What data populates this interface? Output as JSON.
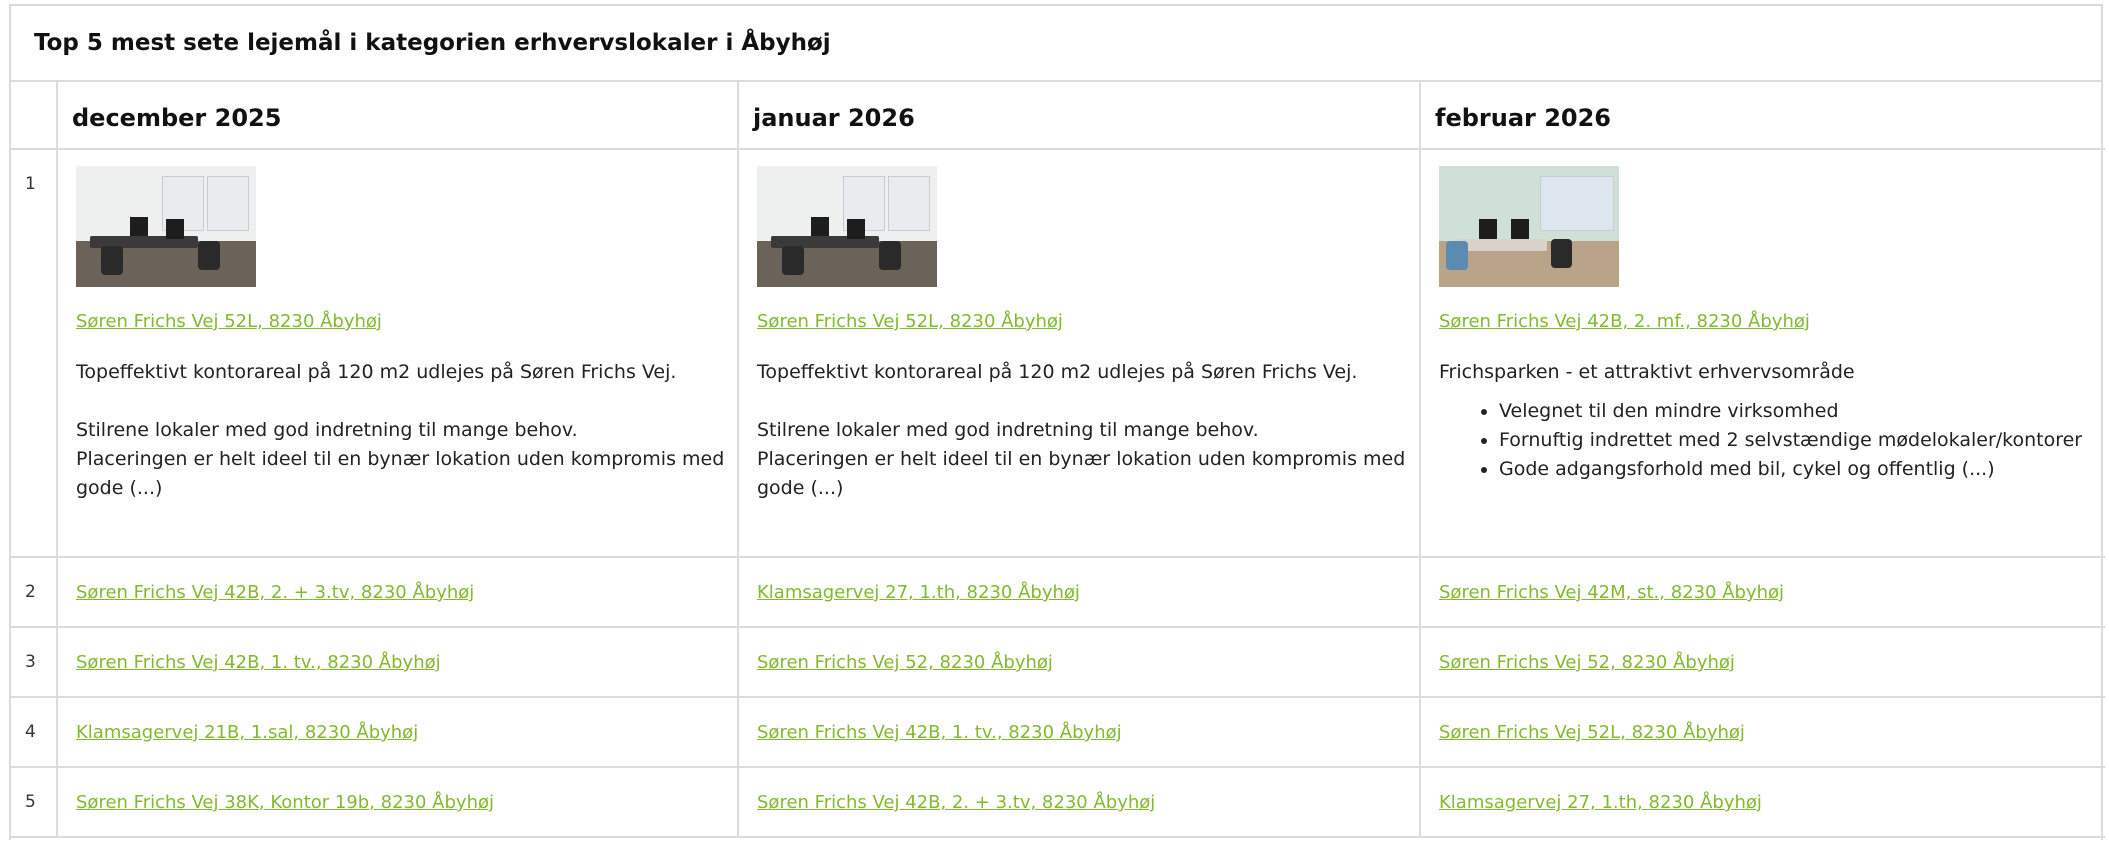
{
  "title": "Top 5 mest sete lejemål i kategorien erhvervslokaler i Åbyhøj",
  "months": [
    "december 2025",
    "januar 2026",
    "februar 2026"
  ],
  "colors": {
    "link": "#82b92e",
    "border": "#dcdcdc"
  },
  "top": {
    "rank": "1",
    "cols": [
      {
        "image": "office-photo",
        "address": "Søren Frichs Vej 52L, 8230 Åbyhøj",
        "p1": "Topeffektivt kontorareal på 120 m2 udlejes på Søren Frichs Vej.",
        "p2a": "Stilrene lokaler med god indretning til mange behov.",
        "p2b": "Placeringen er helt ideel til en bynær lokation uden kompromis med gode (...)"
      },
      {
        "image": "office-photo",
        "address": "Søren Frichs Vej 52L, 8230 Åbyhøj",
        "p1": "Topeffektivt kontorareal på 120 m2 udlejes på Søren Frichs Vej.",
        "p2a": "Stilrene lokaler med god indretning til mange behov.",
        "p2b": "Placeringen er helt ideel til en bynær lokation uden kompromis med gode (...)"
      },
      {
        "image": "office-photo",
        "address": "Søren Frichs Vej 42B, 2. mf., 8230 Åbyhøj",
        "p1": "Frichsparken - et attraktivt erhvervsområde",
        "bullets": [
          "Velegnet til den mindre virksomhed",
          "Fornuftig indrettet med 2 selvstændige mødelokaler/kontorer",
          "Gode adgangsforhold med bil, cykel og offentlig (...)"
        ]
      }
    ]
  },
  "rows": [
    {
      "rank": "2",
      "cells": [
        "Søren Frichs Vej 42B, 2. + 3.tv, 8230 Åbyhøj",
        "Klamsagervej 27, 1.th, 8230 Åbyhøj",
        "Søren Frichs Vej 42M, st., 8230 Åbyhøj"
      ]
    },
    {
      "rank": "3",
      "cells": [
        "Søren Frichs Vej 42B, 1. tv., 8230 Åbyhøj",
        "Søren Frichs Vej 52, 8230 Åbyhøj",
        "Søren Frichs Vej 52, 8230 Åbyhøj"
      ]
    },
    {
      "rank": "4",
      "cells": [
        "Klamsagervej 21B, 1.sal, 8230 Åbyhøj",
        "Søren Frichs Vej 42B, 1. tv., 8230 Åbyhøj",
        "Søren Frichs Vej 52L, 8230 Åbyhøj"
      ]
    },
    {
      "rank": "5",
      "cells": [
        "Søren Frichs Vej 38K, Kontor 19b, 8230 Åbyhøj",
        "Søren Frichs Vej 42B, 2. + 3.tv, 8230 Åbyhøj",
        "Klamsagervej 27, 1.th, 8230 Åbyhøj"
      ]
    }
  ]
}
